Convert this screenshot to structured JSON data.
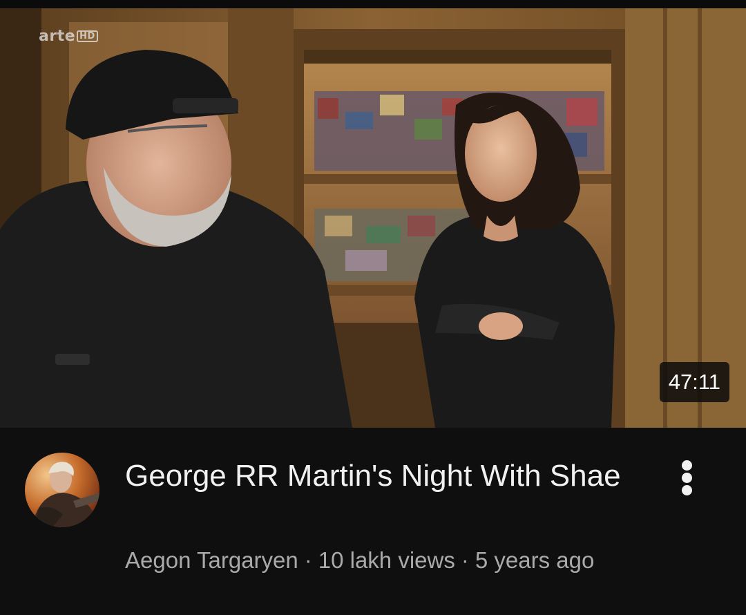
{
  "video": {
    "thumbnail_icon": "video-thumbnail",
    "watermark_text": "arte",
    "watermark_badge": "HD",
    "duration": "47:11",
    "title": "George RR Martin's Night With Shae",
    "channel": "Aegon Targaryen",
    "separator": "·",
    "views": "10 lakh views",
    "age": "5 years ago",
    "menu_icon": "more-vert-icon"
  },
  "colors": {
    "background": "#0f0f0f",
    "title_text": "#f1f1f1",
    "meta_text": "#aaaaaa",
    "duration_badge_bg": "#0c0c0c"
  }
}
